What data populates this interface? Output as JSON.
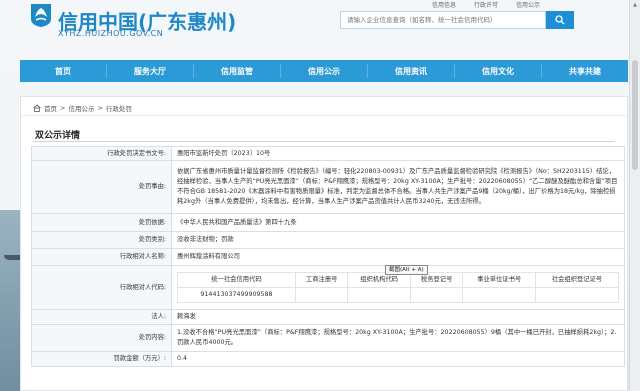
{
  "site": {
    "title": "信用中国(广东惠州)",
    "url": "XYHZ.HUIZHOU.GOV.CN"
  },
  "toplinks": [
    "信用信息",
    "行政许可",
    "信用公示"
  ],
  "search": {
    "placeholder": "请输入企业信息查询（如名称、统一社会信用代码）"
  },
  "nav": [
    "首页",
    "服务大厅",
    "信用监管",
    "信用公示",
    "信用资讯",
    "信用文化",
    "共享共建"
  ],
  "breadcrumb": [
    "首页",
    "信用公示",
    "行政处罚"
  ],
  "section_title": "双公示详情",
  "labels": {
    "doc_no": "行政处罚决定书文号:",
    "reason": "处罚事由:",
    "basis": "处罚依据:",
    "category": "处罚类别:",
    "party_name": "行政相对人名称:",
    "party_code": "行政相对人代码:",
    "legal_rep": "法人:",
    "content": "处罚内容:",
    "amount": "罚款金额（万元）:"
  },
  "values": {
    "doc_no": "惠阳市监新圩处罚〔2023〕10号",
    "reason": "依据广东省惠州市质量计量监督检测所《检验报告》（编号：轻化220803-00931）及广东产品质量监督检验研究院《检测报告》（No：SH2203115）结论，经抽样检验，当事人生产的“PU亮光黑面漆”（商标：P&F翔鹰漆；规格型号：20kg XY-3100A；生产批号：20220608055）“乙二醇醚及醚酯总和含量”项目不符合GB 18581-2020《木器涂料中有害物质限量》标准，判定为监督总体不合格。当事人共生产涉案产品9桶（20kg/桶），出厂价格为18元/kg，除抽检损耗2kg外（当事人免费提供），均未售出，经计算，当事人生产涉案产品货值共计人民币3240元，无违法所得。",
    "basis": "《中华人民共和国产品质量法》第四十九条",
    "category": "没收非法财物；罚款",
    "party_name": "惠州辉煌涂料有限公司",
    "legal_rep": "赖海发",
    "content": "1.没收不合格“PU亮光黑面漆”（商标：P&F翔鹰漆；规格型号：20kg XY-3100A；生产批号：20220608055）9桶（其中一桶已开封，已抽样损耗2kg）；2.罚款人民币4000元。",
    "amount": "0.4"
  },
  "party_code": {
    "headers": [
      "统一社会信用代码",
      "工商注册号",
      "组织机构代码",
      "税务登记号",
      "事业单位证书号",
      "社会组织登记证号"
    ],
    "values": [
      "914413037499909588",
      "",
      "",
      "",
      "",
      ""
    ]
  },
  "tooltip": "截图(Alt + A)"
}
